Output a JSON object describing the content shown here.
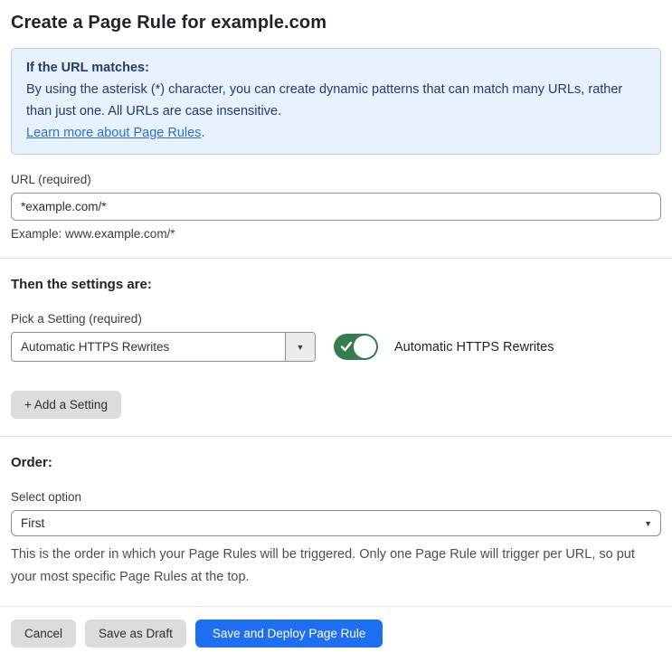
{
  "page": {
    "title": "Create a Page Rule for example.com"
  },
  "info_box": {
    "heading": "If the URL matches:",
    "body": "By using the asterisk (*) character, you can create dynamic patterns that can match many URLs, rather than just one. All URLs are case insensitive.",
    "link_text": "Learn more about Page Rules",
    "link_suffix": "."
  },
  "url_field": {
    "label": "URL (required)",
    "value": "*example.com/*",
    "example": "Example: www.example.com/*"
  },
  "settings_section": {
    "heading": "Then the settings are:",
    "picker_label": "Pick a Setting (required)",
    "picker_value": "Automatic HTTPS Rewrites",
    "toggle_state": "on",
    "toggle_label": "Automatic HTTPS Rewrites",
    "add_setting_label": "+ Add a Setting"
  },
  "order_section": {
    "heading": "Order:",
    "select_label": "Select option",
    "select_value": "First",
    "help_text": "This is the order in which your Page Rules will be triggered. Only one Page Rule will trigger per URL, so put your most specific Page Rules at the top."
  },
  "footer": {
    "cancel_label": "Cancel",
    "save_draft_label": "Save as Draft",
    "save_deploy_label": "Save and Deploy Page Rule"
  },
  "colors": {
    "accent_blue": "#1f6ff2",
    "toggle_green": "#337d4e",
    "info_background": "#e8f2fc",
    "info_border": "#abcdef",
    "info_text": "#1e3c70",
    "link_blue": "#2d6fd6"
  }
}
